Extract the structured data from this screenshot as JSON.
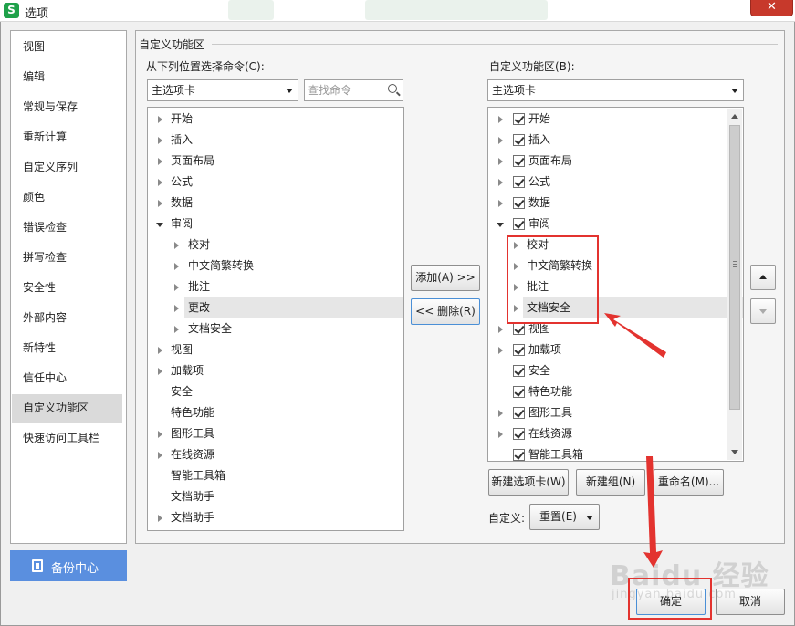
{
  "window": {
    "title": "选项",
    "app_logo": "S",
    "close_glyph": "✕"
  },
  "nav": {
    "items": [
      "视图",
      "编辑",
      "常规与保存",
      "重新计算",
      "自定义序列",
      "颜色",
      "错误检查",
      "拼写检查",
      "安全性",
      "外部内容",
      "新特性",
      "信任中心",
      "自定义功能区",
      "快速访问工具栏"
    ],
    "active": "自定义功能区"
  },
  "backup": {
    "label": "备份中心",
    "icon": "backup-icon"
  },
  "main": {
    "group_title": "自定义功能区",
    "left_label": "从下列位置选择命令(C):",
    "left_combo": "主选项卡",
    "search_placeholder": "查找命令",
    "right_label": "自定义功能区(B):",
    "right_combo": "主选项卡"
  },
  "left_tree": [
    {
      "label": "开始",
      "level": 0,
      "arrow": "right"
    },
    {
      "label": "插入",
      "level": 0,
      "arrow": "right"
    },
    {
      "label": "页面布局",
      "level": 0,
      "arrow": "right"
    },
    {
      "label": "公式",
      "level": 0,
      "arrow": "right"
    },
    {
      "label": "数据",
      "level": 0,
      "arrow": "right"
    },
    {
      "label": "审阅",
      "level": 0,
      "arrow": "down"
    },
    {
      "label": "校对",
      "level": 1,
      "arrow": "right"
    },
    {
      "label": "中文简繁转换",
      "level": 1,
      "arrow": "right"
    },
    {
      "label": "批注",
      "level": 1,
      "arrow": "right"
    },
    {
      "label": "更改",
      "level": 1,
      "arrow": "right",
      "selected": true
    },
    {
      "label": "文档安全",
      "level": 1,
      "arrow": "right"
    },
    {
      "label": "视图",
      "level": 0,
      "arrow": "right"
    },
    {
      "label": "加载项",
      "level": 0,
      "arrow": "right"
    },
    {
      "label": "安全",
      "level": 0,
      "arrow": "none"
    },
    {
      "label": "特色功能",
      "level": 0,
      "arrow": "none"
    },
    {
      "label": "图形工具",
      "level": 0,
      "arrow": "right"
    },
    {
      "label": "在线资源",
      "level": 0,
      "arrow": "right"
    },
    {
      "label": "智能工具箱",
      "level": 0,
      "arrow": "none"
    },
    {
      "label": "文档助手",
      "level": 0,
      "arrow": "none"
    },
    {
      "label": "文档助手",
      "level": 0,
      "arrow": "right"
    }
  ],
  "right_tree": [
    {
      "label": "开始",
      "level": 0,
      "arrow": "right",
      "checked": true
    },
    {
      "label": "插入",
      "level": 0,
      "arrow": "right",
      "checked": true
    },
    {
      "label": "页面布局",
      "level": 0,
      "arrow": "right",
      "checked": true
    },
    {
      "label": "公式",
      "level": 0,
      "arrow": "right",
      "checked": true
    },
    {
      "label": "数据",
      "level": 0,
      "arrow": "right",
      "checked": true
    },
    {
      "label": "审阅",
      "level": 0,
      "arrow": "down",
      "checked": true
    },
    {
      "label": "校对",
      "level": 1,
      "arrow": "right"
    },
    {
      "label": "中文简繁转换",
      "level": 1,
      "arrow": "right"
    },
    {
      "label": "批注",
      "level": 1,
      "arrow": "right"
    },
    {
      "label": "文档安全",
      "level": 1,
      "arrow": "right",
      "selected": true
    },
    {
      "label": "视图",
      "level": 0,
      "arrow": "right",
      "checked": true
    },
    {
      "label": "加载项",
      "level": 0,
      "arrow": "right",
      "checked": true
    },
    {
      "label": "安全",
      "level": 0,
      "arrow": "none",
      "checked": true
    },
    {
      "label": "特色功能",
      "level": 0,
      "arrow": "none",
      "checked": true
    },
    {
      "label": "图形工具",
      "level": 0,
      "arrow": "right",
      "checked": true
    },
    {
      "label": "在线资源",
      "level": 0,
      "arrow": "right",
      "checked": true
    },
    {
      "label": "智能工具箱",
      "level": 0,
      "arrow": "none",
      "checked": true
    }
  ],
  "buttons": {
    "add": "添加(A) >>",
    "remove": "<< 删除(R)",
    "new_tab": "新建选项卡(W)",
    "new_group": "新建组(N)",
    "rename": "重命名(M)...",
    "customize_label": "自定义:",
    "reset": "重置(E)",
    "ok": "确定",
    "cancel": "取消"
  },
  "watermark": {
    "main": "Baidu 经验",
    "sub": "jingyan.baidu.com"
  },
  "colors": {
    "annotation": "#e3332f",
    "nav_active": "#dadada",
    "backup_button": "#5a8fdf"
  }
}
